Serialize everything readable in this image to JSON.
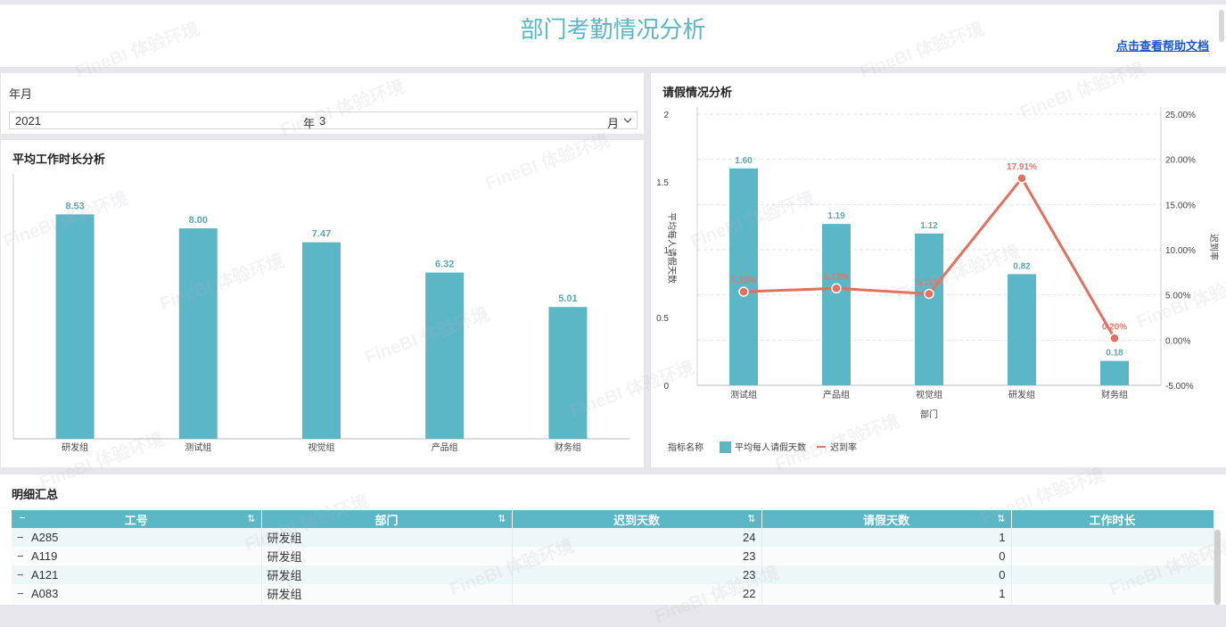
{
  "header": {
    "title": "部门考勤情况分析",
    "help_link": "点击查看帮助文档"
  },
  "filter": {
    "label": "年月",
    "year": "2021",
    "year_suffix": "年",
    "month": "3",
    "month_suffix": "月"
  },
  "chart_data": [
    {
      "type": "bar",
      "title": "平均工作时长分析",
      "categories": [
        "研发组",
        "测试组",
        "视觉组",
        "产品组",
        "财务组"
      ],
      "values": [
        8.53,
        8.0,
        7.47,
        6.32,
        5.01
      ],
      "value_labels": [
        "8.53",
        "8.00",
        "7.47",
        "6.32",
        "5.01"
      ],
      "color": "#5bb6c6",
      "ylim": [
        0,
        10
      ]
    },
    {
      "type": "bar+line",
      "title": "请假情况分析",
      "categories": [
        "测试组",
        "产品组",
        "视觉组",
        "研发组",
        "财务组"
      ],
      "xlabel": "部门",
      "ylabel_left": "平均每人请假天数",
      "ylabel_right": "迟到率",
      "left_ticks": [
        "2",
        "1.5",
        "1",
        "0.5",
        "0"
      ],
      "right_ticks": [
        "25.00%",
        "20.00%",
        "15.00%",
        "10.00%",
        "5.00%",
        "0.00%",
        "-5.00%"
      ],
      "ylim_left": [
        0,
        2
      ],
      "ylim_right": [
        -5,
        25
      ],
      "series": [
        {
          "name": "平均每人请假天数",
          "type": "bar",
          "values": [
            1.6,
            1.19,
            1.12,
            0.82,
            0.18
          ],
          "labels": [
            "1.60",
            "1.19",
            "1.12",
            "0.82",
            "0.18"
          ],
          "color": "#5bb6c6"
        },
        {
          "name": "迟到率",
          "type": "line",
          "values": [
            5.35,
            5.73,
            5.12,
            17.91,
            0.2
          ],
          "labels": [
            "5.35%",
            "5.73%",
            "5.12%",
            "17.91%",
            "0.20%"
          ],
          "color": "#e2705f"
        }
      ],
      "legend_title": "指标名称",
      "legend_placement": "bottom-left"
    }
  ],
  "table": {
    "title": "明细汇总",
    "columns": [
      "工号",
      "部门",
      "迟到天数",
      "请假天数",
      "工作时长"
    ],
    "rows": [
      [
        "A285",
        "研发组",
        "24",
        "1",
        ""
      ],
      [
        "A119",
        "研发组",
        "23",
        "0",
        ""
      ],
      [
        "A121",
        "研发组",
        "23",
        "0",
        ""
      ],
      [
        "A083",
        "研发组",
        "22",
        "1",
        ""
      ]
    ]
  },
  "watermark": "FineBI 体验环境"
}
